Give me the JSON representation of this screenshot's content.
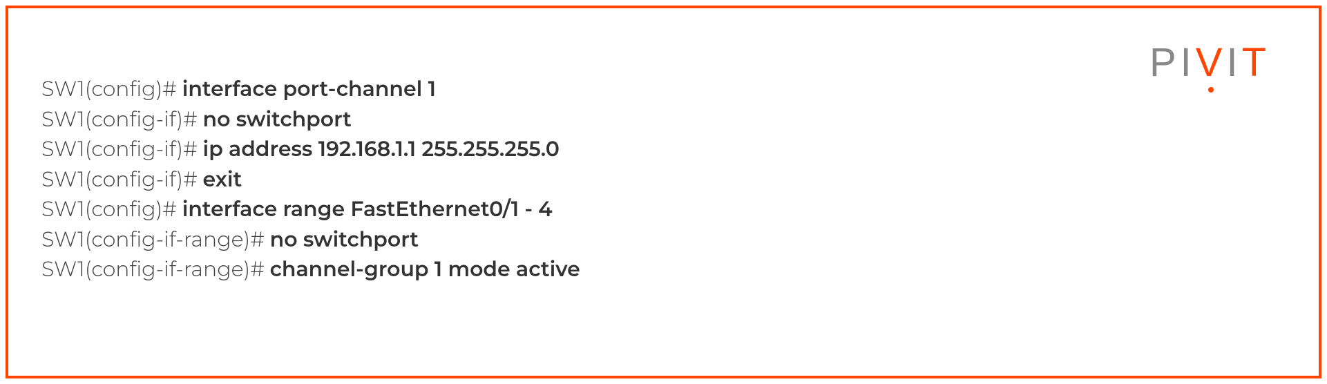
{
  "logo": {
    "p1": "P",
    "i1": "I",
    "v": "V",
    "i2": "I",
    "t": "T"
  },
  "terminal": {
    "lines": [
      {
        "prompt": "SW1(config)# ",
        "command": "interface port-channel 1"
      },
      {
        "prompt": "SW1(config-if)# ",
        "command": "no switchport"
      },
      {
        "prompt": "SW1(config-if)# ",
        "command": "ip address 192.168.1.1 255.255.255.0"
      },
      {
        "prompt": "SW1(config-if)# ",
        "command": "exit"
      },
      {
        "prompt": "SW1(config)# ",
        "command": "interface range FastEthernet0/1 - 4"
      },
      {
        "prompt": "SW1(config-if-range)# ",
        "command": "no switchport"
      },
      {
        "prompt": "SW1(config-if-range)# ",
        "command": "channel-group 1 mode active"
      }
    ]
  }
}
